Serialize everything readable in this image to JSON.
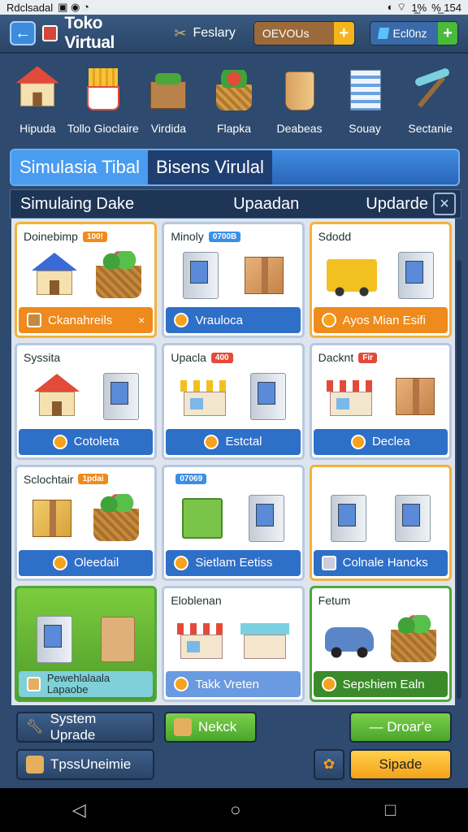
{
  "status": {
    "left": "Rdclsadal",
    "right": "%̲ 154",
    "battery": "1̲̲%"
  },
  "topbar": {
    "title": "Toko Virtual",
    "tool_label": "Feslary",
    "currency1": "OEVOUs",
    "currency2": "Ecl0nz"
  },
  "icons": [
    {
      "label": "Hipuda",
      "icon": "shop-icon"
    },
    {
      "label": "Tollo Gioclaire",
      "icon": "fries-icon"
    },
    {
      "label": "Virdida",
      "icon": "crate-icon"
    },
    {
      "label": "Flapka",
      "icon": "basket-icon"
    },
    {
      "label": "Deabeas",
      "icon": "bucket-icon"
    },
    {
      "label": "Souay",
      "icon": "building-icon"
    },
    {
      "label": "Sectanie",
      "icon": "pickaxe-icon"
    }
  ],
  "panel": {
    "tab1": "Simulasia Tibal",
    "tab2": "Bisens Virulal"
  },
  "subhead": {
    "left": "Simulaing Dake",
    "center": "Upaadan",
    "right": "Updarde"
  },
  "cards": [
    {
      "title": "Doinebimp",
      "tag": "100!",
      "footer": "Ckanahreils",
      "close": "×"
    },
    {
      "title": "Minoly",
      "tag": "0700B",
      "footer": "Vrauloca"
    },
    {
      "title": "Sdodd",
      "tag": "",
      "footer": "Ayos Mian Esifi"
    },
    {
      "title": "Syssita",
      "tag": "",
      "footer": "Cotoleta"
    },
    {
      "title": "Upacla",
      "tag": "400",
      "footer": "Estctal"
    },
    {
      "title": "Dacknt",
      "tag": "Fir",
      "footer": "Declea"
    },
    {
      "title": "Sclochtair",
      "tag": "1pdai",
      "footer": "Oleedail"
    },
    {
      "title": "",
      "tag": "07069",
      "footer": "Sietlam Eetiss"
    },
    {
      "title": "",
      "tag": "",
      "footer": "Colnale Hancks"
    },
    {
      "title": "",
      "tag": "",
      "footer": "Pewehlalaala Lapaobe"
    },
    {
      "title": "Eloblenan",
      "tag": "",
      "footer": "Takk Vreten"
    },
    {
      "title": "Fetum",
      "tag": "",
      "footer": "Sepshiem Ealn"
    }
  ],
  "buttons": {
    "system_upgrade": "System Uprade",
    "next": "Nekck",
    "droar": "— Droar'e",
    "tpss": "TpssUneimie",
    "sipade": "Sipade"
  },
  "colors": {
    "accent": "#3d8bdc",
    "gold": "#f2b33a",
    "green": "#4fa83a",
    "orange": "#ef8a1c"
  }
}
